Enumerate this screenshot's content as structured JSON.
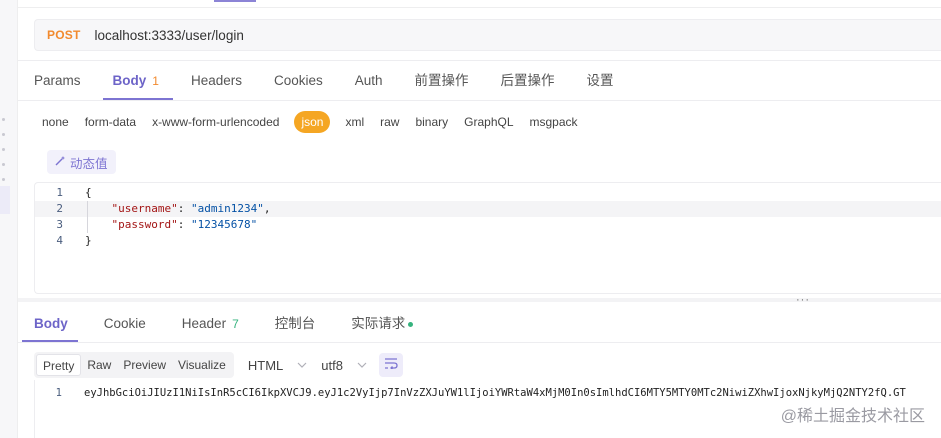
{
  "request": {
    "method": "POST",
    "url": "localhost:3333/user/login"
  },
  "request_tabs": [
    {
      "label": "Params"
    },
    {
      "label": "Body",
      "badge": "1"
    },
    {
      "label": "Headers"
    },
    {
      "label": "Cookies"
    },
    {
      "label": "Auth"
    },
    {
      "label": "前置操作"
    },
    {
      "label": "后置操作"
    },
    {
      "label": "设置"
    }
  ],
  "body_types": [
    "none",
    "form-data",
    "x-www-form-urlencoded",
    "json",
    "xml",
    "raw",
    "binary",
    "GraphQL",
    "msgpack"
  ],
  "dynamic_value_label": "动态值",
  "editor": {
    "lines": [
      {
        "num": "1",
        "text": "{"
      },
      {
        "num": "2",
        "key": "\"username\"",
        "value": "\"admin1234\"",
        "trail": ","
      },
      {
        "num": "3",
        "key": "\"password\"",
        "value": "\"12345678\"",
        "trail": ""
      },
      {
        "num": "4",
        "text": "}"
      }
    ]
  },
  "splitter_handle": "···",
  "response_tabs": [
    {
      "label": "Body"
    },
    {
      "label": "Cookie"
    },
    {
      "label": "Header",
      "count": "7"
    },
    {
      "label": "控制台"
    },
    {
      "label": "实际请求"
    }
  ],
  "view_modes": [
    "Pretty",
    "Raw",
    "Preview",
    "Visualize"
  ],
  "format_select": "HTML",
  "encoding_select": "utf8",
  "response_line": {
    "num": "1",
    "text": "eyJhbGciOiJIUzI1NiIsInR5cCI6IkpXVCJ9.eyJ1c2VyIjp7InVzZXJuYW1lIjoiYWRtaW4xMjM0In0sImlhdCI6MTY5MTY0MTc2NiwiZXhwIjoxNjkyMjQ2NTY2fQ.GT"
  },
  "watermark": "@稀土掘金技术社区",
  "colors": {
    "accent": "#7d74d2",
    "method": "#f28a2e",
    "json_pill": "#f5a623",
    "status_green": "#36b37e"
  }
}
